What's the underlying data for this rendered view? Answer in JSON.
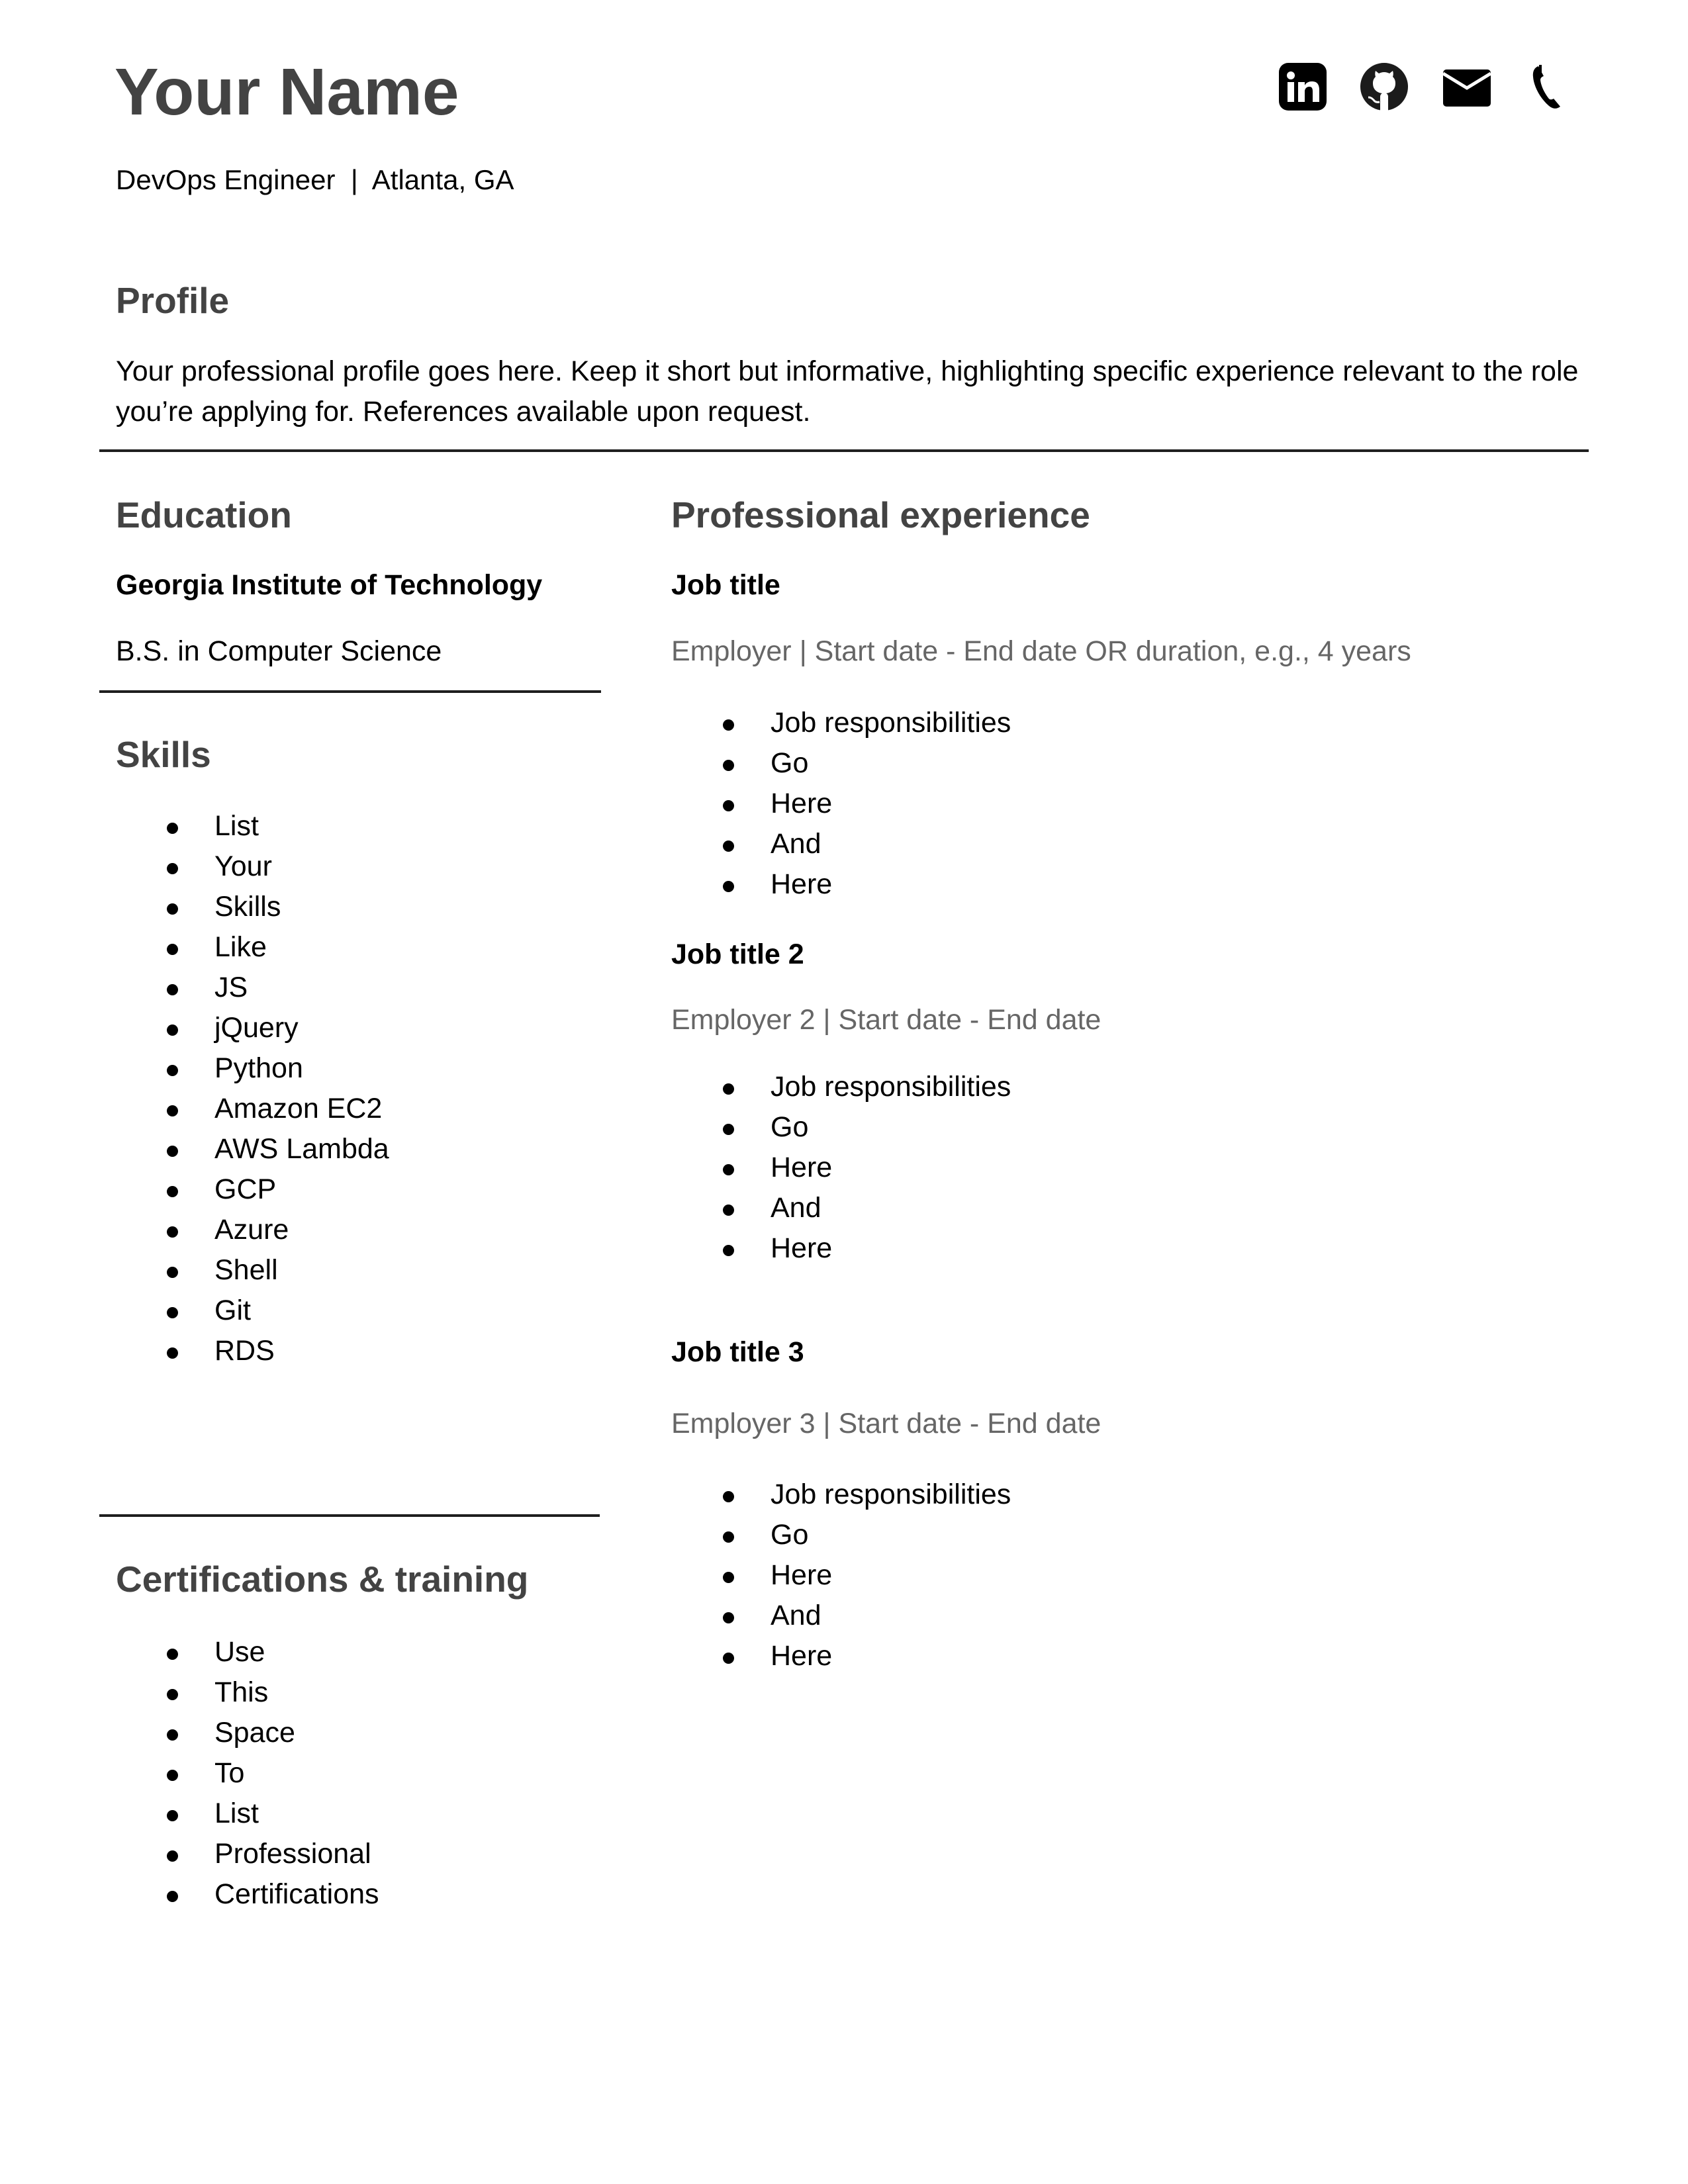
{
  "header": {
    "name": "Your Name",
    "subtitle": "DevOps Engineer  |  Atlanta, GA",
    "contact_icons": [
      {
        "icon": "linkedin-icon",
        "label": "LinkedIn"
      },
      {
        "icon": "github-icon",
        "label": "GitHub"
      },
      {
        "icon": "mail-icon",
        "label": "Email"
      },
      {
        "icon": "phone-icon",
        "label": "Phone"
      }
    ]
  },
  "profile": {
    "heading": "Profile",
    "text": "Your professional profile goes here. Keep it short but informative, highlighting specific experience relevant to the role you’re applying for. References available upon request."
  },
  "education": {
    "heading": "Education",
    "school": "Georgia Institute of Technology",
    "degree": "B.S. in Computer Science"
  },
  "skills": {
    "heading": "Skills",
    "items": [
      "List",
      "Your",
      "Skills",
      "Like",
      "JS",
      "jQuery",
      "Python",
      "Amazon EC2",
      "AWS Lambda",
      "GCP",
      "Azure",
      "Shell",
      "Git",
      "RDS"
    ]
  },
  "certifications": {
    "heading": "Certifications & training",
    "items": [
      "Use",
      "This",
      "Space",
      "To",
      "List",
      "Professional",
      "Certifications"
    ]
  },
  "experience": {
    "heading": "Professional experience",
    "jobs": [
      {
        "title": "Job title",
        "meta": "Employer | Start date - End date OR duration, e.g., 4 years",
        "bullets": [
          "Job responsibilities",
          "Go",
          "Here",
          "And",
          "Here"
        ]
      },
      {
        "title": "Job title 2",
        "meta": "Employer 2 | Start date - End date",
        "bullets": [
          "Job responsibilities",
          "Go",
          "Here",
          "And",
          "Here"
        ]
      },
      {
        "title": "Job title 3",
        "meta": "Employer 3 | Start date - End date",
        "bullets": [
          "Job responsibilities",
          "Go",
          "Here",
          "And",
          "Here"
        ]
      }
    ]
  },
  "colors": {
    "heading": "#434343",
    "muted": "#666666",
    "text": "#000000",
    "rule": "#1f1f1f"
  }
}
